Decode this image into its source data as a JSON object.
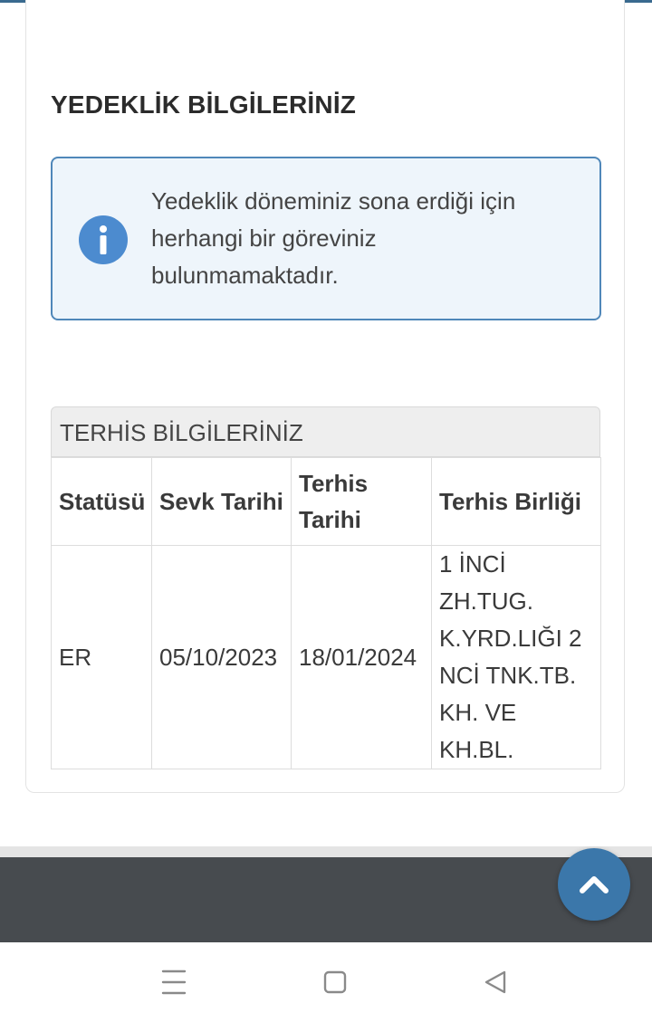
{
  "page": {
    "section_title": "YEDEKLİK BİLGİLERİNİZ",
    "alert": {
      "icon": "info-icon",
      "message": "Yedeklik döneminiz sona erdiği için herhangi bir göreviniz bulunmamaktadır.",
      "color": "#4c8bcf"
    }
  },
  "discharge_table": {
    "caption": "TERHİS BİLGİLERİNİZ",
    "headers": {
      "status": "Statüsü",
      "dispatch_date": "Sevk Tarihi",
      "discharge_date": "Terhis Tarihi",
      "discharge_unit": "Terhis Birliği"
    },
    "rows": [
      {
        "status": "ER",
        "dispatch_date": "05/10/2023",
        "discharge_date": "18/01/2024",
        "discharge_unit": "1 İNCİ ZH.TUG. K.YRD.LIĞI 2 NCİ TNK.TB. KH. VE KH.BL."
      }
    ]
  },
  "scroll_top": {
    "icon": "chevron-up-icon",
    "color": "#3b77aa"
  },
  "system_nav": {
    "menu": "menu-icon",
    "home": "home-square-icon",
    "back": "back-triangle-icon"
  }
}
